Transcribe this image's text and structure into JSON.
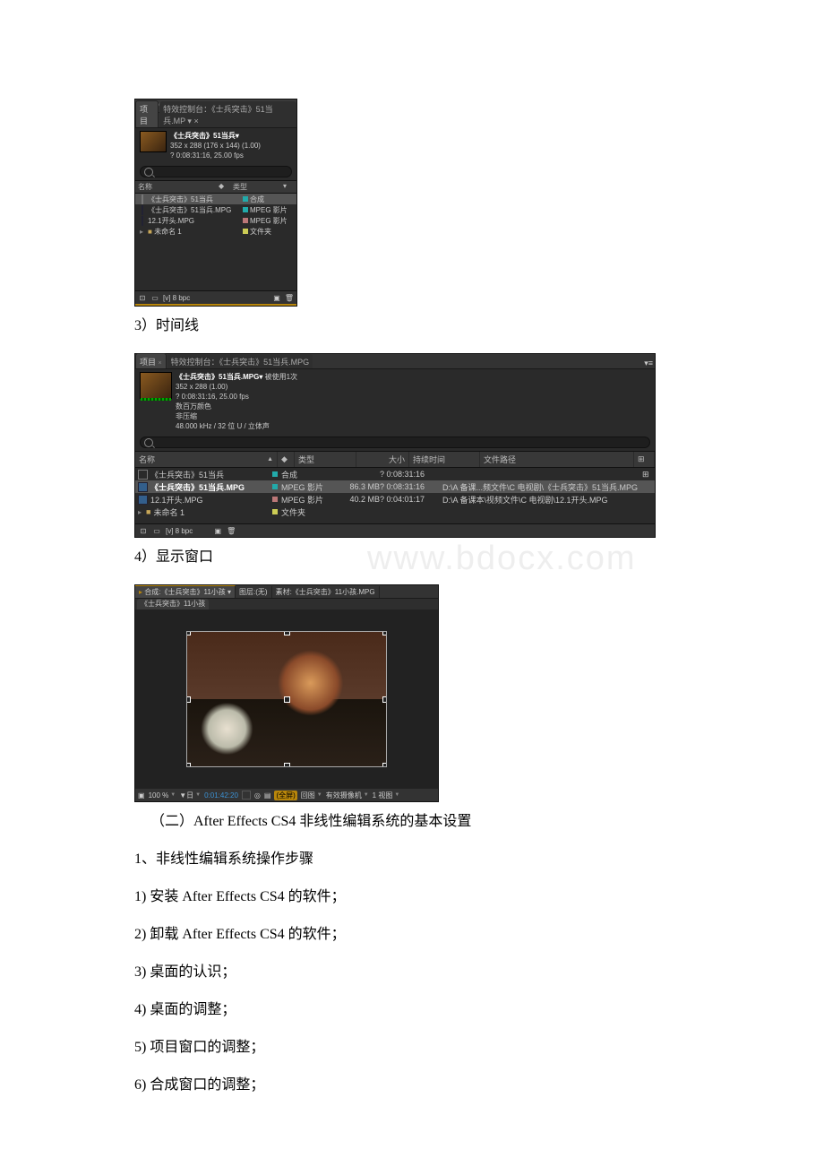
{
  "panel1": {
    "tabs": {
      "project": "项目",
      "effects_tab": "特效控制台：《士兵突击》51当兵.MP ▾ ×"
    },
    "tools": [
      "▶",
      "✋",
      "🔍",
      "↻",
      "⊞",
      "✎",
      "T",
      "◆",
      "✒",
      "✦"
    ],
    "info": {
      "title_bold": "《士兵突击》51当兵▾",
      "line2": "352 x 288 (176 x 144) (1.00)",
      "line3": "? 0:08:31:16, 25.00 fps"
    },
    "cols": {
      "name": "名称",
      "type": "类型"
    },
    "rows": [
      {
        "name": "《士兵突击》51当兵",
        "type": "合成",
        "color": "teal",
        "icon": "comp",
        "selected": true
      },
      {
        "name": "《士兵突击》51当兵.MPG",
        "type": "MPEG 影片",
        "color": "teal",
        "icon": "file"
      },
      {
        "name": "12.1开头.MPG",
        "type": "MPEG 影片",
        "color": "pink",
        "icon": "file"
      },
      {
        "name": "未命名 1",
        "type": "文件夹",
        "color": "yellow",
        "icon": "folder"
      }
    ],
    "footer": {
      "bpc": "[v] 8 bpc"
    }
  },
  "caption_timeline": "3）时间线",
  "panel2": {
    "tabs": {
      "project": "项目",
      "effects_tab": "特效控制台：《士兵突击》51当兵.MPG"
    },
    "info": {
      "title_bold": "《士兵突击》51当兵.MPG▾",
      "used": " 被使用1次",
      "line2": "352 x 288 (1.00)",
      "line3": "? 0:08:31:16, 25.00 fps",
      "line4": "数百万颜色",
      "line5": "非压缩",
      "line6": "48.000 kHz / 32 位 U / 立体声"
    },
    "cols": {
      "name": "名称",
      "type": "类型",
      "size": "大小",
      "dur": "持续时间",
      "path": "文件路径"
    },
    "rows": [
      {
        "name": "《士兵突击》51当兵",
        "type": "合成",
        "size": "",
        "dur": "? 0:08:31:16",
        "path": "",
        "color": "teal",
        "icon": "comp"
      },
      {
        "name": "《士兵突击》51当兵.MPG",
        "type": "MPEG 影片",
        "size": "86.3 MB",
        "dur": "? 0:08:31:16",
        "path": "D:\\A 备课...频文件\\C 电视剧\\《士兵突击》51当兵.MPG",
        "color": "teal",
        "icon": "file",
        "selected": true
      },
      {
        "name": "12.1开头.MPG",
        "type": "MPEG 影片",
        "size": "40.2 MB",
        "dur": "? 0:04:01:17",
        "path": "D:\\A 备课本\\视频文件\\C 电视剧\\12.1开头.MPG",
        "color": "pink",
        "icon": "file"
      },
      {
        "name": "未命名 1",
        "type": "文件夹",
        "size": "",
        "dur": "",
        "path": "",
        "color": "yellow",
        "icon": "folder"
      }
    ],
    "footer": {
      "bpc": "[v] 8 bpc"
    }
  },
  "caption_display": "4）显示窗口",
  "watermark": "www.bdocx.com",
  "panel3": {
    "tab_comp": "合成:《士兵突击》11小孩 ▾",
    "tab_layer": "图层:(无)",
    "tab_footage": "素材:《士兵突击》11小孩.MPG",
    "sub_tab": "《士兵突击》11小孩",
    "bottom": {
      "zoom": "100 %",
      "resolution": "▼日",
      "timecode": "0:01:42:20",
      "grid": "□",
      "auto": "(全屏)",
      "mask": "回图",
      "camera": "有效摄像机",
      "view": "1 视图"
    }
  },
  "doc": {
    "section": "（二）After Effects CS4 非线性编辑系统的基本设置",
    "h1": "1、非线性编辑系统操作步骤",
    "s1": "1) 安装 After Effects CS4 的软件；",
    "s2": "2) 卸载 After Effects CS4 的软件；",
    "s3": "3) 桌面的认识；",
    "s4": "4) 桌面的调整；",
    "s5": "5) 项目窗口的调整；",
    "s6": "6) 合成窗口的调整；"
  }
}
